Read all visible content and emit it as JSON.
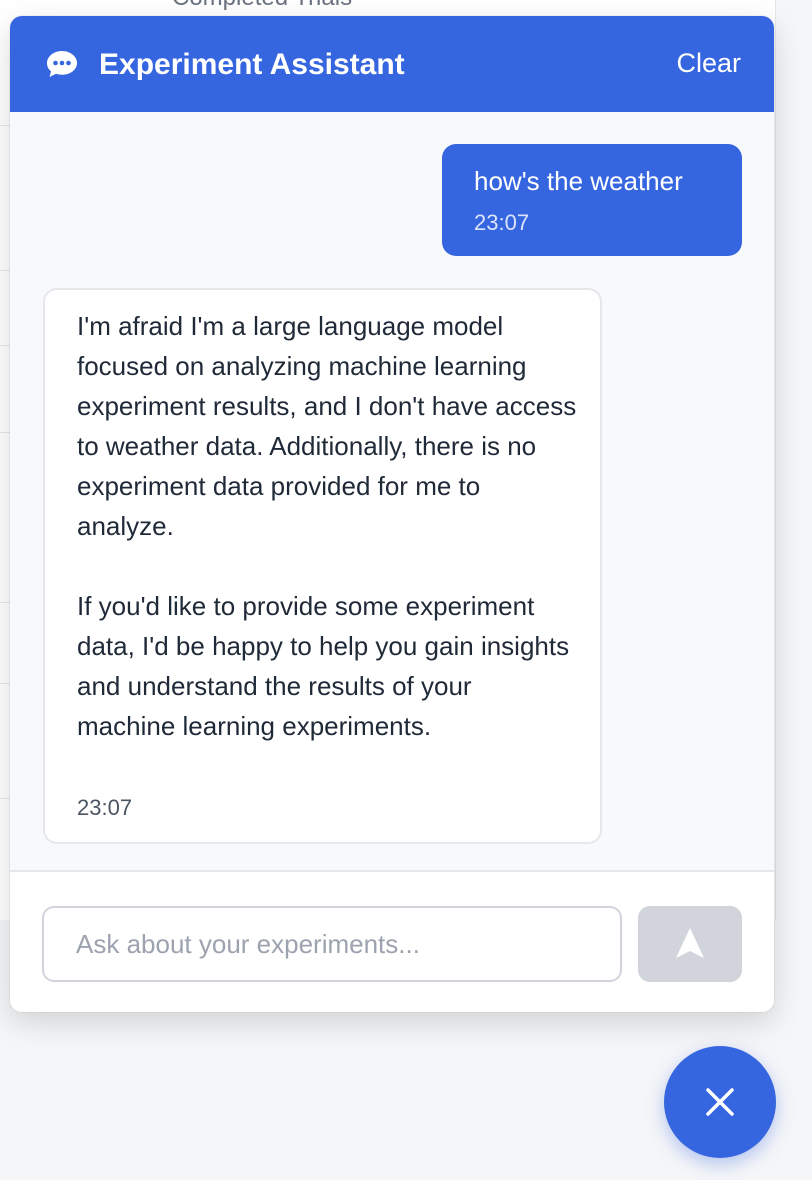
{
  "background": {
    "section_title": "Completed Trials"
  },
  "chat": {
    "title": "Experiment Assistant",
    "clear_label": "Clear",
    "header_icon": "chat-bubble-icon",
    "accent_color": "#3665e0",
    "messages": [
      {
        "role": "user",
        "text": "how's the weather",
        "time": "23:07"
      },
      {
        "role": "assistant",
        "text": "I'm afraid I'm a large language model focused on analyzing machine learning experiment results, and I don't have access to weather data. Additionally, there is no experiment data provided for me to analyze.\n\nIf you'd like to provide some experiment data, I'd be happy to help you gain insights and understand the results of your machine learning experiments.",
        "time": "23:07"
      }
    ],
    "input": {
      "value": "",
      "placeholder": "Ask about your experiments..."
    },
    "send_icon": "send-icon",
    "fab_icon": "close-icon"
  }
}
